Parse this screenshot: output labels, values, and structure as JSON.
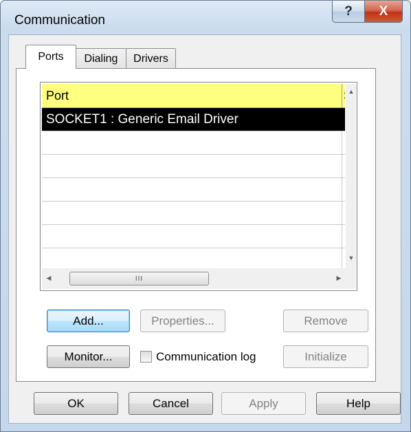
{
  "window": {
    "title": "Communication",
    "help_glyph": "?",
    "close_glyph": "X"
  },
  "tabs": [
    {
      "label": "Ports",
      "active": true
    },
    {
      "label": "Dialing",
      "active": false
    },
    {
      "label": "Drivers",
      "active": false
    }
  ],
  "ports_list": {
    "columns": [
      "Port",
      "S"
    ],
    "rows": [
      "SOCKET1 : Generic Email Driver",
      "",
      "",
      "",
      "",
      "",
      ""
    ],
    "selected_index": 0,
    "hscroll_grip": "III",
    "header_color": "#ffff80"
  },
  "buttons": {
    "add": "Add...",
    "properties": "Properties...",
    "remove": "Remove",
    "monitor": "Monitor...",
    "initialize": "Initialize",
    "ok": "OK",
    "cancel": "Cancel",
    "apply": "Apply",
    "help": "Help"
  },
  "communication_log": {
    "label": "Communication log",
    "checked": false
  }
}
